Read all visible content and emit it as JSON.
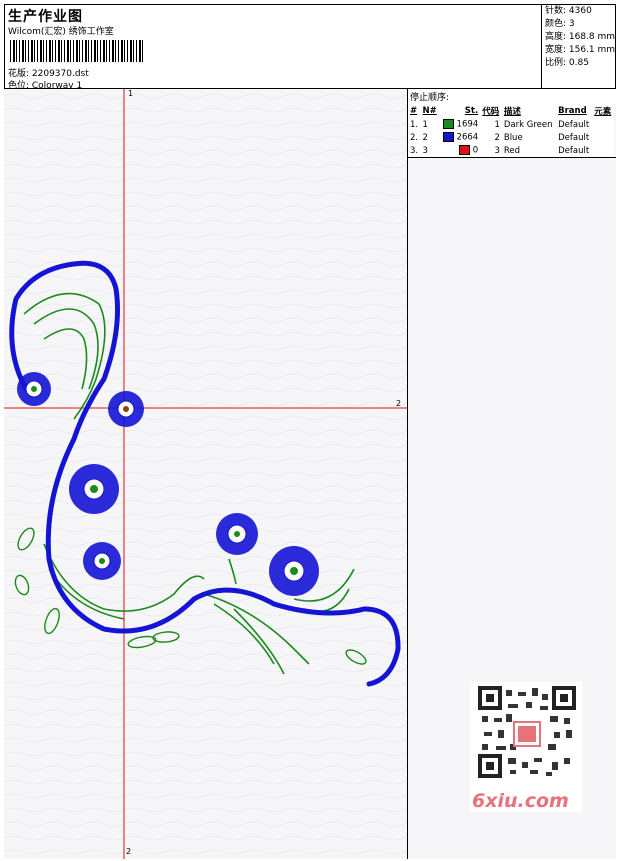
{
  "header": {
    "title": "生产作业图",
    "company": "Wilcom(汇宏) 绣饰工作室",
    "design_label": "花版: 2209370.dst",
    "colorway_label": "色位: Colorway 1"
  },
  "stats": {
    "stitches": "针数: 4360",
    "colors": "颜色: 3",
    "height": "高度: 168.8 mm",
    "width": "宽度: 156.1 mm",
    "scale": "比例: 0.85"
  },
  "stop_sequence": {
    "title": "停止顺序:",
    "columns": [
      "#",
      "N#",
      "St.",
      "代码",
      "描述",
      "Brand",
      "元素"
    ],
    "rows": [
      {
        "idx": "1.",
        "n": "1",
        "color": "#1a8a1a",
        "st": "1694",
        "code": "1",
        "desc": "Dark Green",
        "brand": "Default"
      },
      {
        "idx": "2.",
        "n": "2",
        "color": "#1414d4",
        "st": "2664",
        "code": "2",
        "desc": "Blue",
        "brand": "Default"
      },
      {
        "idx": "3.",
        "n": "3",
        "color": "#e01010",
        "st": "0",
        "code": "3",
        "desc": "Red",
        "brand": "Default"
      }
    ]
  },
  "canvas": {
    "axis_top": "1",
    "axis_right": "2",
    "axis_bottom": "2"
  },
  "watermark": {
    "site": "6xiu.com"
  },
  "colors": {
    "green": "#1a8a1a",
    "blue": "#1414d4",
    "red": "#e01010"
  }
}
